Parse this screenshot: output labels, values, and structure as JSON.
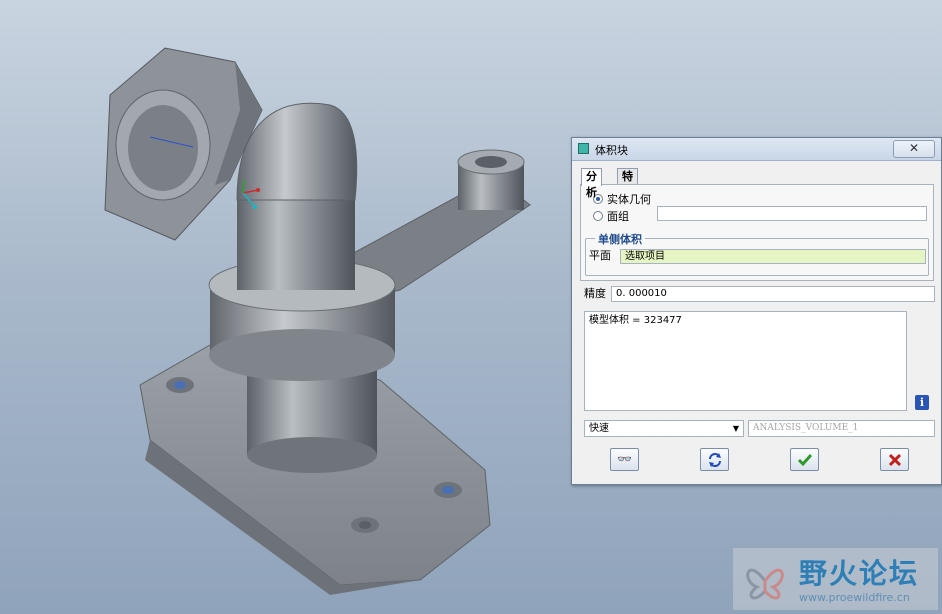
{
  "dialog": {
    "title": "体积块",
    "close_glyph": "✕",
    "tabs": [
      "分析",
      "特征"
    ],
    "geometry_option_solid": "实体几何",
    "geometry_option_quilt": "面组",
    "one_side_volume_group": "单侧体积",
    "plane_label": "平面",
    "plane_value": "选取项目",
    "precision_label": "精度",
    "precision_value": "0. 000010",
    "result_text": "模型体积 = 323477",
    "mode_value": "快速",
    "analysis_name": "ANALYSIS_VOLUME_1",
    "info_glyph": "i"
  },
  "buttons": {
    "preview_icon": "glasses-icon",
    "repeat_icon": "repeat-icon",
    "ok_icon": "checkmark-icon",
    "cancel_icon": "x-icon"
  },
  "watermark": {
    "title": "野火论坛",
    "url": "www.proewildfire.cn"
  },
  "colors": {
    "background_top": "#c9d4e0",
    "background_bottom": "#8fa3bb",
    "model": "#8c9197",
    "selection_highlight": "#e6f5c4",
    "ok_green": "#2e9a2e",
    "cancel_red": "#c2201d",
    "group_title_blue": "#1f4b8e"
  }
}
